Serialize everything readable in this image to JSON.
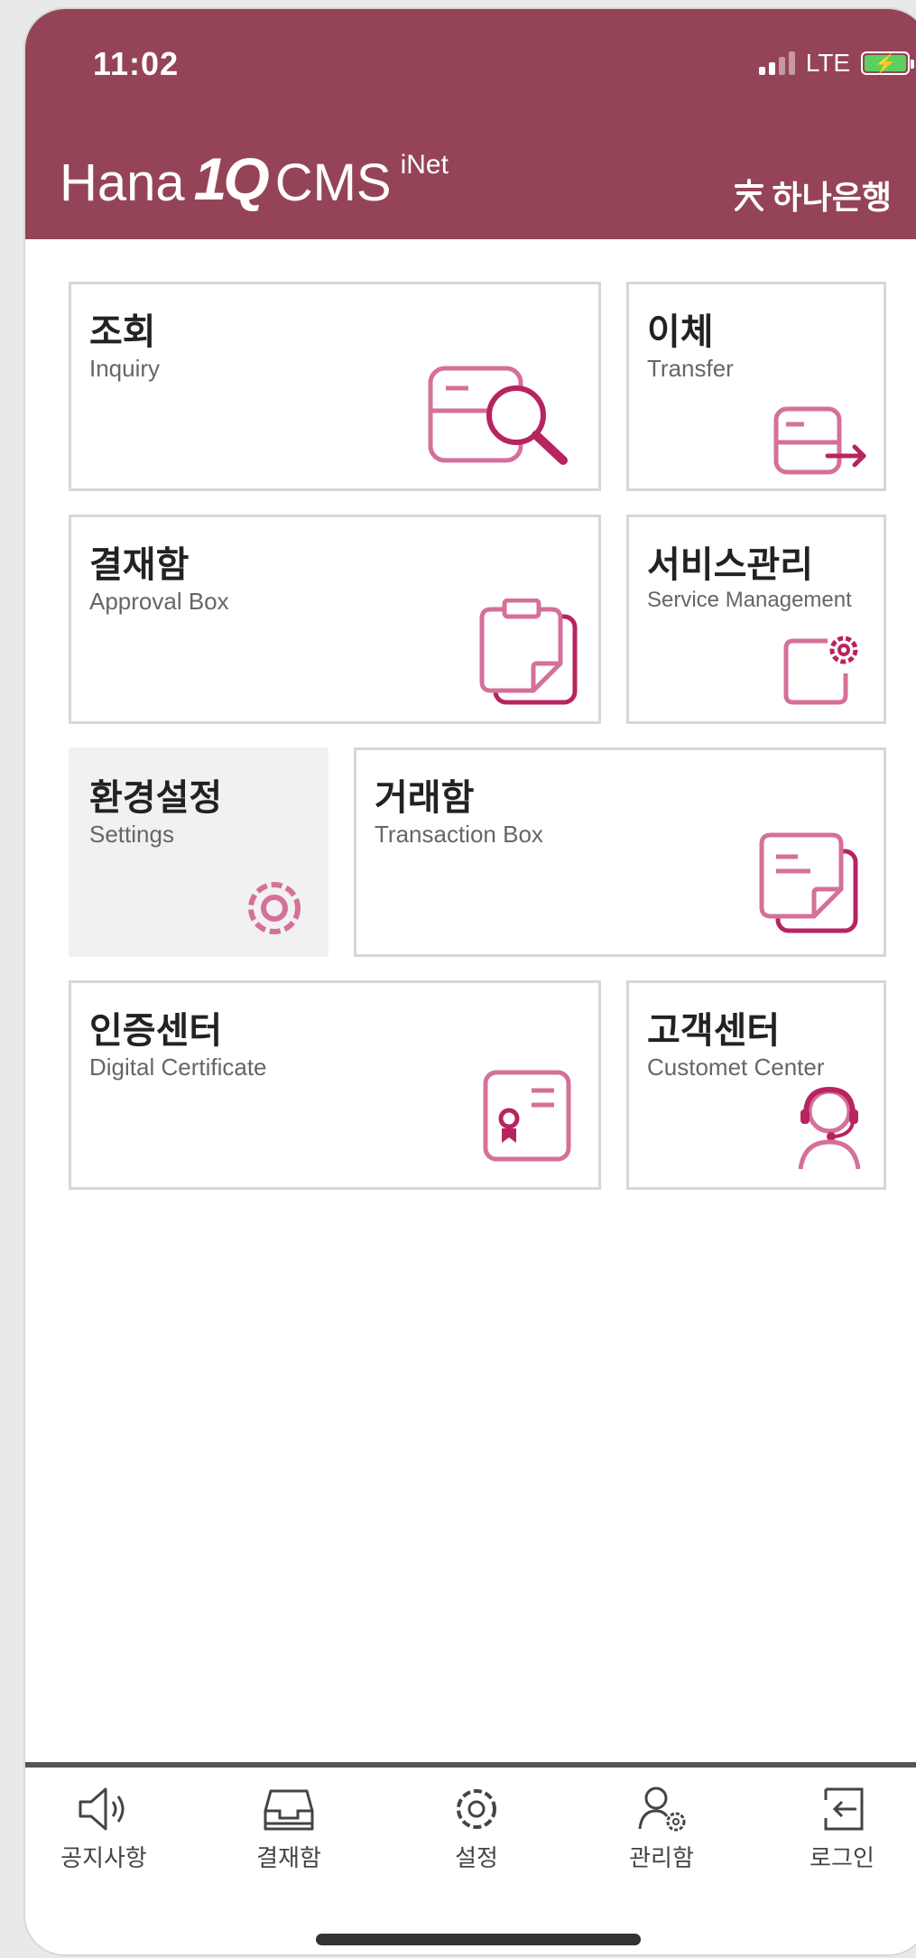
{
  "status_bar": {
    "time": "11:02",
    "network": "LTE"
  },
  "header": {
    "brand": "Hana",
    "brand_mark": "1Q",
    "product": "CMS",
    "product_suffix": "iNet",
    "bank_name": "하나은행"
  },
  "menu": {
    "inquiry": {
      "ko": "조회",
      "en": "Inquiry",
      "icon": "inquiry-search-icon"
    },
    "transfer": {
      "ko": "이체",
      "en": "Transfer",
      "icon": "transfer-icon"
    },
    "approval": {
      "ko": "결재함",
      "en": "Approval Box",
      "icon": "approval-box-icon"
    },
    "service": {
      "ko": "서비스관리",
      "en": "Service Management",
      "icon": "service-management-icon"
    },
    "settings": {
      "ko": "환경설정",
      "en": "Settings",
      "icon": "gear-icon"
    },
    "transaction": {
      "ko": "거래함",
      "en": "Transaction Box",
      "icon": "transaction-box-icon"
    },
    "certificate": {
      "ko": "인증센터",
      "en": "Digital Certificate",
      "icon": "certificate-icon"
    },
    "customer": {
      "ko": "고객센터",
      "en": "Customet Center",
      "icon": "customer-support-icon"
    }
  },
  "bottom_nav": [
    {
      "label": "공지사항",
      "icon": "speaker-icon"
    },
    {
      "label": "결재함",
      "icon": "inbox-icon"
    },
    {
      "label": "설정",
      "icon": "gear-icon"
    },
    {
      "label": "관리함",
      "icon": "user-settings-icon"
    },
    {
      "label": "로그인",
      "icon": "login-icon"
    }
  ],
  "colors": {
    "header": "#954457",
    "icon_light": "#d4709a",
    "icon_dark": "#b8245f"
  }
}
